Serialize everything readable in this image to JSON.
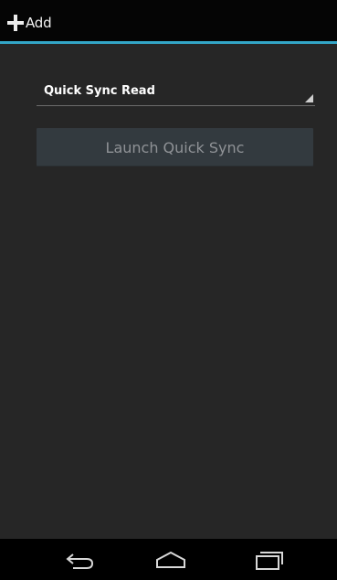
{
  "action_bar": {
    "add_label": "Add",
    "accent_color": "#33a6c7"
  },
  "spinner": {
    "selected_value": "Quick Sync Read"
  },
  "launch_button": {
    "label": "Launch Quick Sync"
  },
  "nav_bar": {
    "icons": [
      "back-icon",
      "home-icon",
      "recents-icon"
    ]
  }
}
